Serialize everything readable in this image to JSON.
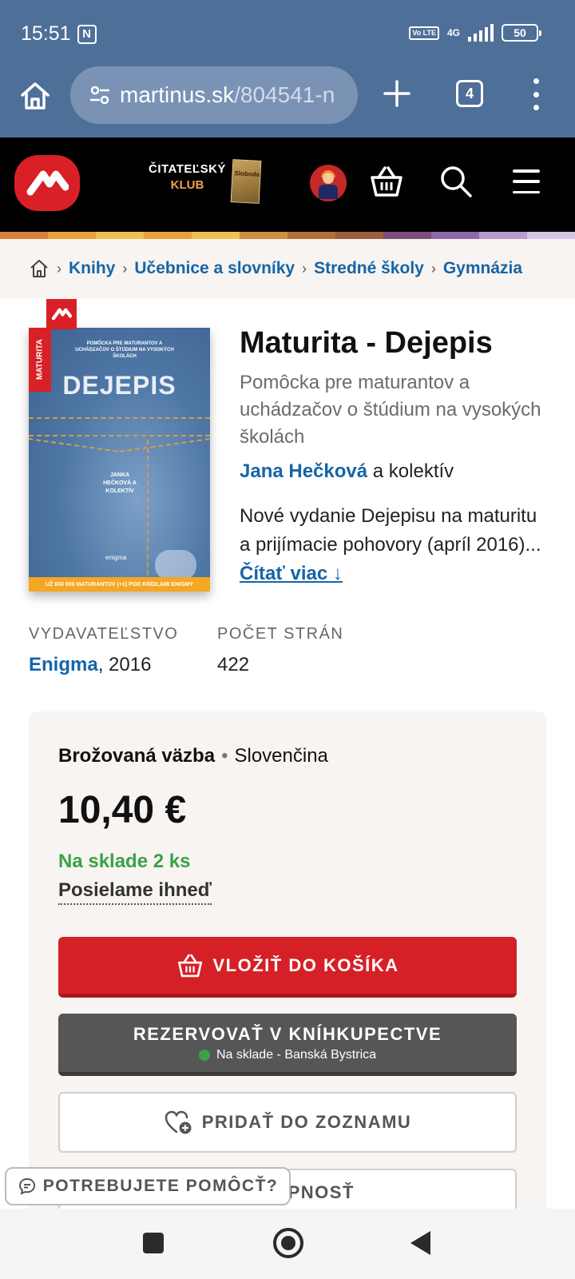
{
  "status_bar": {
    "time": "15:51",
    "network": "4G",
    "volte": "Vo LTE",
    "battery": "50"
  },
  "browser": {
    "url_host": "martinus.sk",
    "url_path": "/804541-n",
    "tab_count": "4"
  },
  "site_header": {
    "club_line1": "ČITATEĽSKÝ",
    "club_line2": "KLUB",
    "club_magazine": "Sloboda"
  },
  "breadcrumb": [
    "Knihy",
    "Učebnice a slovníky",
    "Stredné školy",
    "Gymnázia"
  ],
  "book": {
    "title": "Maturita - Dejepis",
    "subtitle": "Pomôcka pre maturantov a uchádzačov o štúdium na vysokých školách",
    "author": "Jana Hečková",
    "author_suffix": " a kolektív",
    "description": "Nové vydanie Dejepisu na maturitu a prijímacie pohovory (apríl 2016)...",
    "read_more": "Čítať viac ↓",
    "cover": {
      "ribbon": "MATURITA",
      "subtitle": "POMÔCKA PRE MATURANTOV A UCHÁDZAČOV O ŠTÚDIUM NA VYSOKÝCH ŠKOLÁCH",
      "title": "DEJEPIS",
      "authors": "JANKA HEČKOVÁ A KOLEKTÍV",
      "publisher": "enigma",
      "band": "UŽ 650 000 MATURANTOV (+1) POD KRÍDLAMI ENIGMY"
    }
  },
  "meta": {
    "publisher_label": "VYDAVATEĽSTVO",
    "publisher": "Enigma",
    "year": ", 2016",
    "pages_label": "POČET STRÁN",
    "pages": "422"
  },
  "purchase": {
    "binding": "Brožovaná väzba",
    "language": "Slovenčina",
    "price": "10,40 €",
    "stock": "Na sklade 2 ks",
    "shipping": "Posielame ihneď",
    "add_to_cart": "VLOŽIŤ DO KOŠÍKA",
    "reserve": "REZERVOVAŤ V KNÍHKUPECTVE",
    "reserve_stock": "Na sklade - Banská Bystrica",
    "add_to_list": "PRIDAŤ DO ZOZNAMU",
    "availability": "DOSTUPNOSŤ"
  },
  "help": {
    "label": "POTREBUJETE POMÔCŤ?"
  },
  "colors": {
    "brand_red": "#d92027",
    "link_blue": "#1565a8",
    "stock_green": "#3aa248",
    "browser_blue": "#4e6f98"
  }
}
